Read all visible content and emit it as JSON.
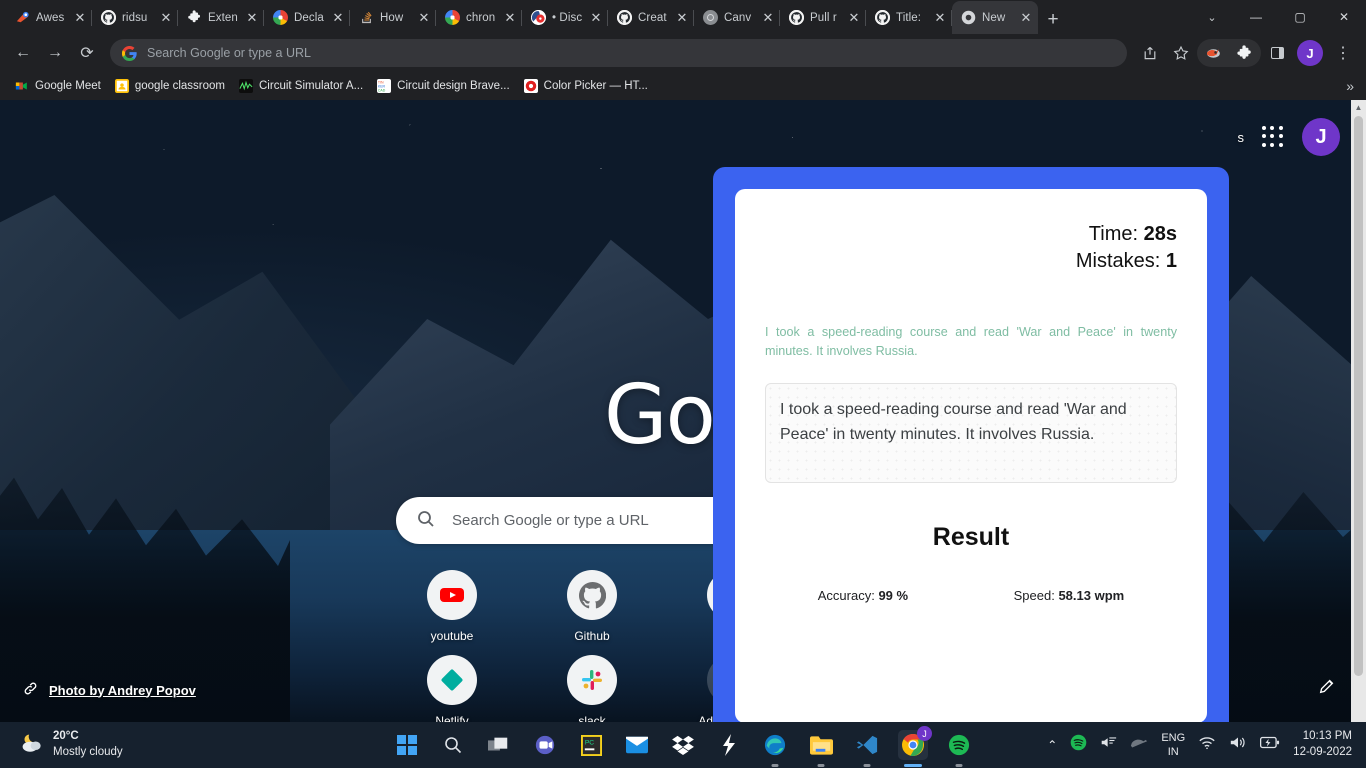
{
  "browser": {
    "tabs": [
      {
        "title": "Awes",
        "favicon": "awesome-icon"
      },
      {
        "title": "ridsu",
        "favicon": "github-icon"
      },
      {
        "title": "Exten",
        "favicon": "puzzle-icon"
      },
      {
        "title": "Decla",
        "favicon": "chrome-icon"
      },
      {
        "title": "How",
        "favicon": "stackoverflow-icon"
      },
      {
        "title": "chron",
        "favicon": "chrome-icon"
      },
      {
        "title": "• Disc",
        "favicon": "disc-icon"
      },
      {
        "title": "Creat",
        "favicon": "github-icon"
      },
      {
        "title": "Canv",
        "favicon": "globe-icon"
      },
      {
        "title": "Pull r",
        "favicon": "github-icon"
      },
      {
        "title": "Title:",
        "favicon": "github-icon"
      },
      {
        "title": "New",
        "favicon": "chrome-icon"
      }
    ],
    "new_tab_label": "+",
    "window_controls": {
      "tab_search": "⌄",
      "minimize": "—",
      "maximize": "▢",
      "close": "✕"
    },
    "nav": {
      "back": "←",
      "forward": "→",
      "reload": "⟳"
    },
    "omnibox": {
      "placeholder": "Search Google or type a URL",
      "value": ""
    },
    "toolbar_right": {
      "share_label": "share-icon",
      "bookmark_label": "star-icon",
      "extension_label": "extension-icon",
      "puzzle_label": "puzzle-icon",
      "sidepanel_label": "side-panel-icon",
      "profile_initial": "J",
      "menu_label": "⋮"
    },
    "bookmarks": [
      {
        "label": "Google Meet",
        "icon": "google-meet-icon"
      },
      {
        "label": "google classroom",
        "icon": "classroom-icon"
      },
      {
        "label": "Circuit Simulator A...",
        "icon": "circuit-sim-icon"
      },
      {
        "label": "Circuit design Brave...",
        "icon": "tinkercad-icon"
      },
      {
        "label": "Color Picker — HT...",
        "icon": "colorpicker-icon"
      }
    ],
    "bookmarks_overflow": "»"
  },
  "newtab": {
    "gmail_label": "s",
    "apps_label": "apps-grid-icon",
    "profile_initial": "J",
    "logo_text": "Goo",
    "search_placeholder": "Search Google or type a URL",
    "shortcuts": [
      {
        "label": "youtube",
        "icon": "youtube-icon"
      },
      {
        "label": "Github",
        "icon": "github-icon"
      },
      {
        "label": "",
        "icon": "generic-icon"
      },
      {
        "label": "",
        "icon": "generic-icon"
      },
      {
        "label": "Netlify",
        "icon": "netlify-icon"
      },
      {
        "label": "slack",
        "icon": "slack-icon"
      },
      {
        "label": "Add shortcut",
        "icon": "plus-icon"
      }
    ],
    "photo_credit": "Photo by Andrey Popov",
    "customize_label": "pencil-icon"
  },
  "modal": {
    "time_label": "Time: ",
    "time_value": "28s",
    "mistakes_label": "Mistakes: ",
    "mistakes_value": "1",
    "quote": "I took a speed-reading course and read 'War and Peace' in twenty minutes. It involves Russia.",
    "typed_text": "I took a speed-reading course and read 'War and Peace' in twenty minutes. It involves Russia.",
    "result_title": "Result",
    "accuracy_label": "Accuracy: ",
    "accuracy_value": "99 %",
    "speed_label": "Speed: ",
    "speed_value": "58.13 wpm",
    "accent_color": "#3b63f0",
    "quote_color": "#7fbda3"
  },
  "taskbar": {
    "weather_temp": "20°C",
    "weather_desc": "Mostly cloudy",
    "apps": [
      {
        "name": "start-button"
      },
      {
        "name": "search-icon"
      },
      {
        "name": "task-view-icon"
      },
      {
        "name": "teams-icon"
      },
      {
        "name": "pycharm-icon"
      },
      {
        "name": "mail-icon"
      },
      {
        "name": "dropbox-icon"
      },
      {
        "name": "flash-icon"
      },
      {
        "name": "edge-icon"
      },
      {
        "name": "file-explorer-icon"
      },
      {
        "name": "vscode-icon"
      },
      {
        "name": "chrome-icon"
      },
      {
        "name": "spotify-icon"
      }
    ],
    "tray": {
      "chevron": "⌃",
      "spotify": "spotify-tray-icon",
      "volume_mixer": "volume-mixer-icon",
      "mouse": "mouse-icon",
      "lang_line1": "ENG",
      "lang_line2": "IN",
      "wifi": "wifi-icon",
      "volume": "volume-icon",
      "battery": "battery-charging-icon",
      "time": "10:13 PM",
      "date": "12-09-2022"
    }
  }
}
